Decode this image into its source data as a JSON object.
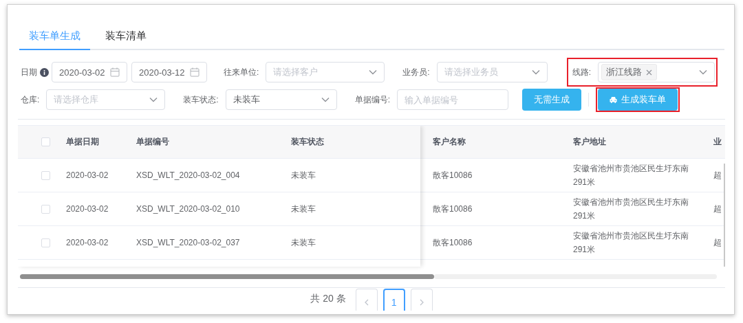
{
  "tabs": [
    {
      "label": "装车单生成",
      "selected": true
    },
    {
      "label": "装车清单",
      "selected": false
    }
  ],
  "filter_rows": [
    [
      {
        "kind": "date-range",
        "label": "日期",
        "values": [
          "2020-03-02",
          "2020-03-12"
        ]
      },
      {
        "kind": "select",
        "label": "往来单位:",
        "placeholder": "请选择客户"
      },
      {
        "kind": "select",
        "label": "业务员:",
        "placeholder": "请选择业务员"
      },
      {
        "kind": "select",
        "label": "线路:",
        "tags": [
          "浙江线路"
        ],
        "highlighted": true
      }
    ],
    [
      {
        "kind": "select",
        "label": "仓库:",
        "placeholder": "请选择仓库"
      },
      {
        "kind": "select",
        "label": "装车状态:",
        "value": "未装车"
      },
      {
        "kind": "input",
        "label": "单据编号:",
        "placeholder": "输入单据编号"
      },
      {
        "kind": "button",
        "label": "无需生成",
        "highlighted": false
      },
      {
        "kind": "carbutton",
        "label": "生成装车单",
        "highlighted": true
      }
    ]
  ],
  "table": {
    "all_checked": false,
    "columns": [
      "单据日期",
      "单据编号",
      "装车状态",
      "客户名称",
      "客户地址",
      "业"
    ],
    "rows": [
      {
        "checked": false,
        "cells": [
          "2020-03-02",
          "XSD_WLT_2020-03-02_004",
          "未装车",
          "散客10086",
          "安徽省池州市贵池区民生圩东南291米",
          "超"
        ]
      },
      {
        "checked": false,
        "cells": [
          "2020-03-02",
          "XSD_WLT_2020-03-02_010",
          "未装车",
          "散客10086",
          "安徽省池州市贵池区民生圩东南291米",
          "超"
        ]
      },
      {
        "checked": false,
        "cells": [
          "2020-03-02",
          "XSD_WLT_2020-03-02_037",
          "未装车",
          "散客10086",
          "安徽省池州市贵池区民生圩东南291米",
          "超"
        ]
      }
    ]
  },
  "pagination": {
    "total": "共 20 条",
    "pages": [
      {
        "label": "1",
        "selected": true
      }
    ]
  }
}
